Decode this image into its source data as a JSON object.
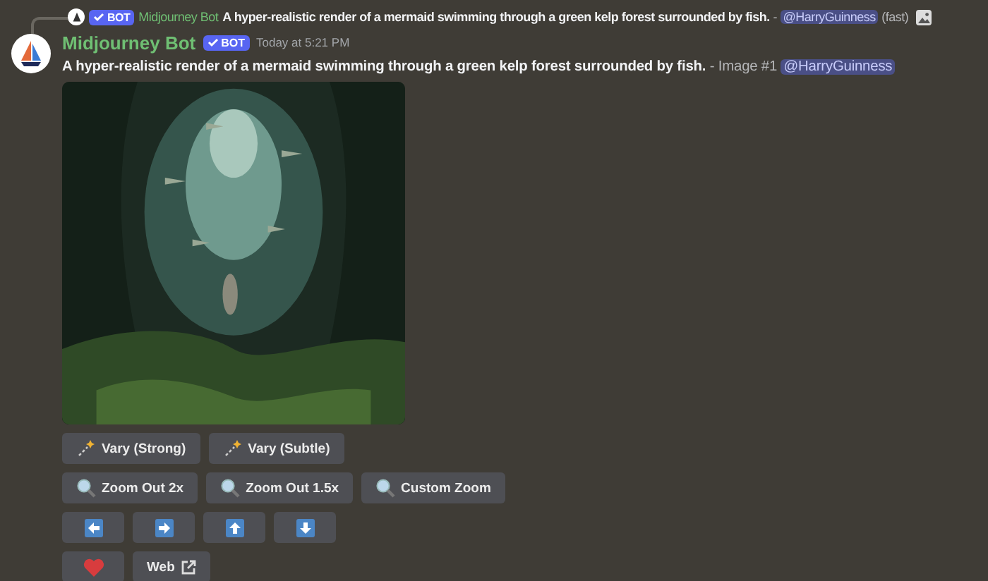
{
  "reply": {
    "author": "Midjourney Bot",
    "badge": "BOT",
    "prompt": "A hyper-realistic render of a mermaid swimming through a green kelp forest surrounded by fish.",
    "suffix": "-",
    "mention": "@HarryGuinness",
    "tag": "(fast)"
  },
  "message": {
    "author": "Midjourney Bot",
    "badge": "BOT",
    "timestamp": "Today at 5:21 PM",
    "prompt": "A hyper-realistic render of a mermaid swimming through a green kelp forest surrounded by fish.",
    "suffix": "- Image #1",
    "mention": "@HarryGuinness"
  },
  "button_rows": [
    [
      {
        "kind": "vary",
        "label": "Vary (Strong)"
      },
      {
        "kind": "vary",
        "label": "Vary (Subtle)"
      }
    ],
    [
      {
        "kind": "zoom",
        "label": "Zoom Out 2x"
      },
      {
        "kind": "zoom",
        "label": "Zoom Out 1.5x"
      },
      {
        "kind": "zoom",
        "label": "Custom Zoom"
      }
    ],
    [
      {
        "kind": "arrow-left"
      },
      {
        "kind": "arrow-right"
      },
      {
        "kind": "arrow-up"
      },
      {
        "kind": "arrow-down"
      }
    ],
    [
      {
        "kind": "like"
      },
      {
        "kind": "link",
        "label": "Web"
      }
    ]
  ]
}
